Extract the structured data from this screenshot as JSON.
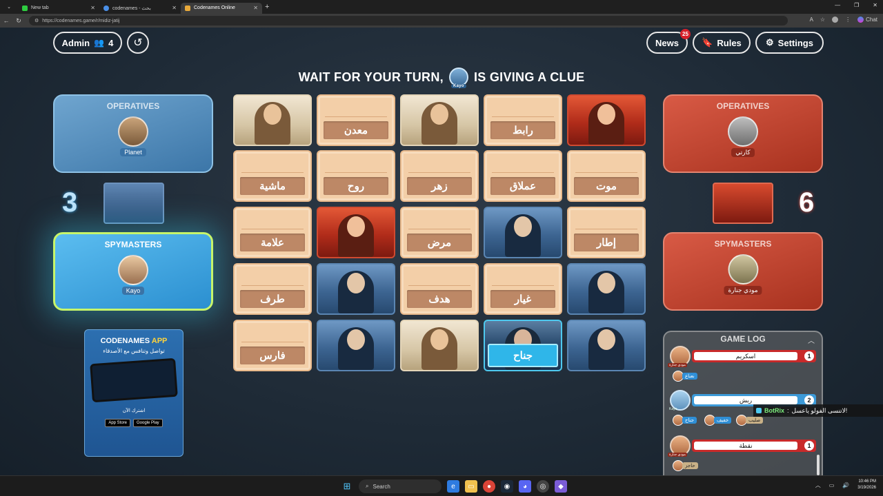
{
  "browser": {
    "tabs": [
      {
        "label": "New tab",
        "active": false
      },
      {
        "label": "codenames - بحث",
        "active": false
      },
      {
        "label": "Codenames Online",
        "active": true
      }
    ],
    "url": "https://codenames.game/r/midiz-jatij",
    "chat_label": "Chat"
  },
  "header": {
    "admin_label": "Admin",
    "player_count": "4",
    "news_label": "News",
    "news_badge": "25",
    "rules_label": "Rules",
    "settings_label": "Settings"
  },
  "banner": {
    "prefix": "WAIT FOR YOUR TURN,",
    "player": "Kayo",
    "suffix": "IS GIVING A CLUE"
  },
  "blue_team": {
    "operatives_label": "OPERATIVES",
    "operative": "Planet",
    "spymasters_label": "SPYMASTERS",
    "spymaster": "Kayo",
    "score": "3"
  },
  "red_team": {
    "operatives_label": "OPERATIVES",
    "operative": "كارتي",
    "spymasters_label": "SPYMASTERS",
    "spymaster": "مودي جنارة",
    "score": "6"
  },
  "board": [
    {
      "type": "bystander",
      "word": ""
    },
    {
      "type": "word",
      "word": "معدن"
    },
    {
      "type": "bystander",
      "word": ""
    },
    {
      "type": "word",
      "word": "رابط"
    },
    {
      "type": "agent-red",
      "word": ""
    },
    {
      "type": "word",
      "word": "ماشية"
    },
    {
      "type": "word",
      "word": "روح"
    },
    {
      "type": "word",
      "word": "زهر"
    },
    {
      "type": "word",
      "word": "عملاق"
    },
    {
      "type": "word",
      "word": "موت"
    },
    {
      "type": "word",
      "word": "علامة"
    },
    {
      "type": "agent-red",
      "word": ""
    },
    {
      "type": "word",
      "word": "مرض"
    },
    {
      "type": "agent-blue",
      "word": ""
    },
    {
      "type": "word",
      "word": "إطار"
    },
    {
      "type": "word",
      "word": "طرف"
    },
    {
      "type": "agent-blue",
      "word": ""
    },
    {
      "type": "word",
      "word": "هدف"
    },
    {
      "type": "word",
      "word": "غيار"
    },
    {
      "type": "agent-blue",
      "word": ""
    },
    {
      "type": "word",
      "word": "فارس"
    },
    {
      "type": "agent-blue",
      "word": ""
    },
    {
      "type": "bystander",
      "word": ""
    },
    {
      "type": "selected",
      "word": "جناح"
    },
    {
      "type": "agent-blue",
      "word": ""
    }
  ],
  "ad": {
    "title_main": "CODENAMES",
    "title_accent": "APP",
    "subtitle": "تواصل وتنافس مع الأصدقاء",
    "cta": "اشترك الآن",
    "store1": "App Store",
    "store2": "Google Play"
  },
  "game_log": {
    "title": "GAME LOG",
    "entries": [
      {
        "team": "red",
        "player": "مودي جنارة",
        "clue": "اسكريم",
        "number": "1",
        "guesses": [
          {
            "word": "نعناع",
            "style": "blue"
          }
        ]
      },
      {
        "team": "blue",
        "player": "Kayo",
        "clue": "ريش",
        "number": "2",
        "guesses": [
          {
            "word": "جناح",
            "style": "blue"
          },
          {
            "word": "خفيف",
            "style": "blue"
          },
          {
            "word": "صليب",
            "style": "bys"
          }
        ]
      },
      {
        "team": "red",
        "player": "مودي جنارة",
        "clue": "نقطة",
        "number": "1",
        "guesses": [
          {
            "word": "حاجز",
            "style": "neutral"
          }
        ]
      }
    ]
  },
  "botrix": {
    "name": "BotRix",
    "message": "لاتنسى الفولو ياعسل!"
  },
  "taskbar": {
    "search_label": "Search",
    "time": "10:46 PM",
    "date": "3/19/2026"
  }
}
